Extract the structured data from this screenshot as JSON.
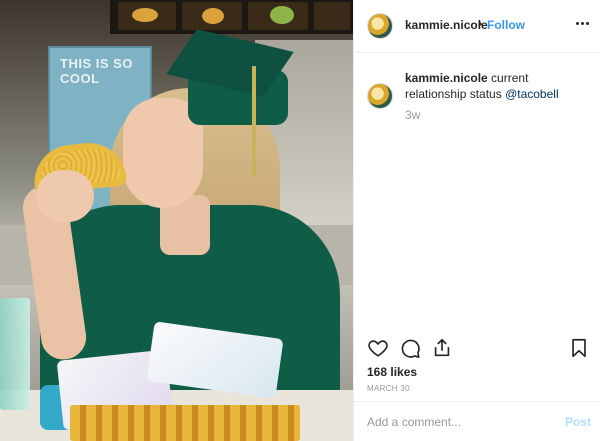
{
  "header": {
    "username": "kammie.nicole",
    "separator": "•",
    "follow_label": "Follow",
    "more_icon": "more-horizontal-icon"
  },
  "photo": {
    "poster_text": "THIS IS SO COOL"
  },
  "caption": {
    "username": "kammie.nicole",
    "text": " current relationship status ",
    "mention": "@tacobell",
    "time": "3w"
  },
  "actions": {
    "like_icon": "heart-icon",
    "comment_icon": "comment-icon",
    "share_icon": "share-icon",
    "save_icon": "bookmark-icon"
  },
  "likes": "168 likes",
  "date": "MARCH 30",
  "comment": {
    "placeholder": "Add a comment...",
    "post_label": "Post"
  },
  "colors": {
    "link": "#3897f0",
    "post_disabled": "#b2dffc",
    "gown": "#0f5c47"
  }
}
